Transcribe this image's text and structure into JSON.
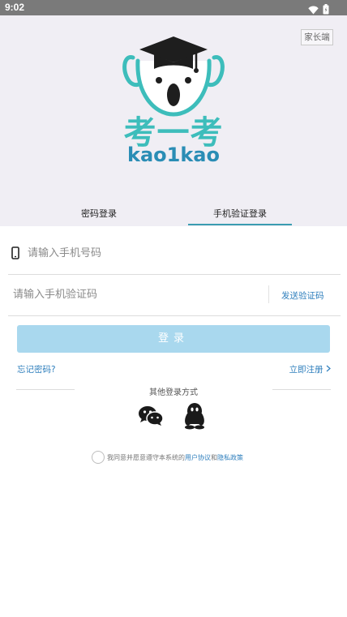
{
  "status_bar": {
    "time": "9:02",
    "wifi_icon": "wifi-icon",
    "battery_icon": "battery-icon"
  },
  "header": {
    "parent_button": "家长端",
    "brand_cn": "考一考",
    "brand_en": "kao1kao",
    "logo_icon": "koala-graduation-cap-logo"
  },
  "tabs": [
    {
      "label": "密码登录",
      "active": false
    },
    {
      "label": "手机验证登录",
      "active": true
    }
  ],
  "form": {
    "phone_placeholder": "请输入手机号码",
    "code_placeholder": "请输入手机验证码",
    "send_code": "发送验证码",
    "login_button": "登录",
    "forgot_password": "忘记密码?",
    "register": "立即注册"
  },
  "other_login": {
    "title": "其他登录方式",
    "methods": [
      {
        "icon": "wechat-icon"
      },
      {
        "icon": "qq-icon"
      }
    ]
  },
  "agreement": {
    "prefix": "我同意并愿意遵守本系统的",
    "user_agreement": "用户协议",
    "and": "和",
    "privacy_policy": "隐私政策",
    "checked": false
  },
  "colors": {
    "accent": "#3a9cb1",
    "link": "#2f7fbd",
    "login_button": "#a9d8ee",
    "brand_teal": "#3dbdbb",
    "brand_blue": "#2a8db5",
    "header_bg": "#f0eef4"
  }
}
